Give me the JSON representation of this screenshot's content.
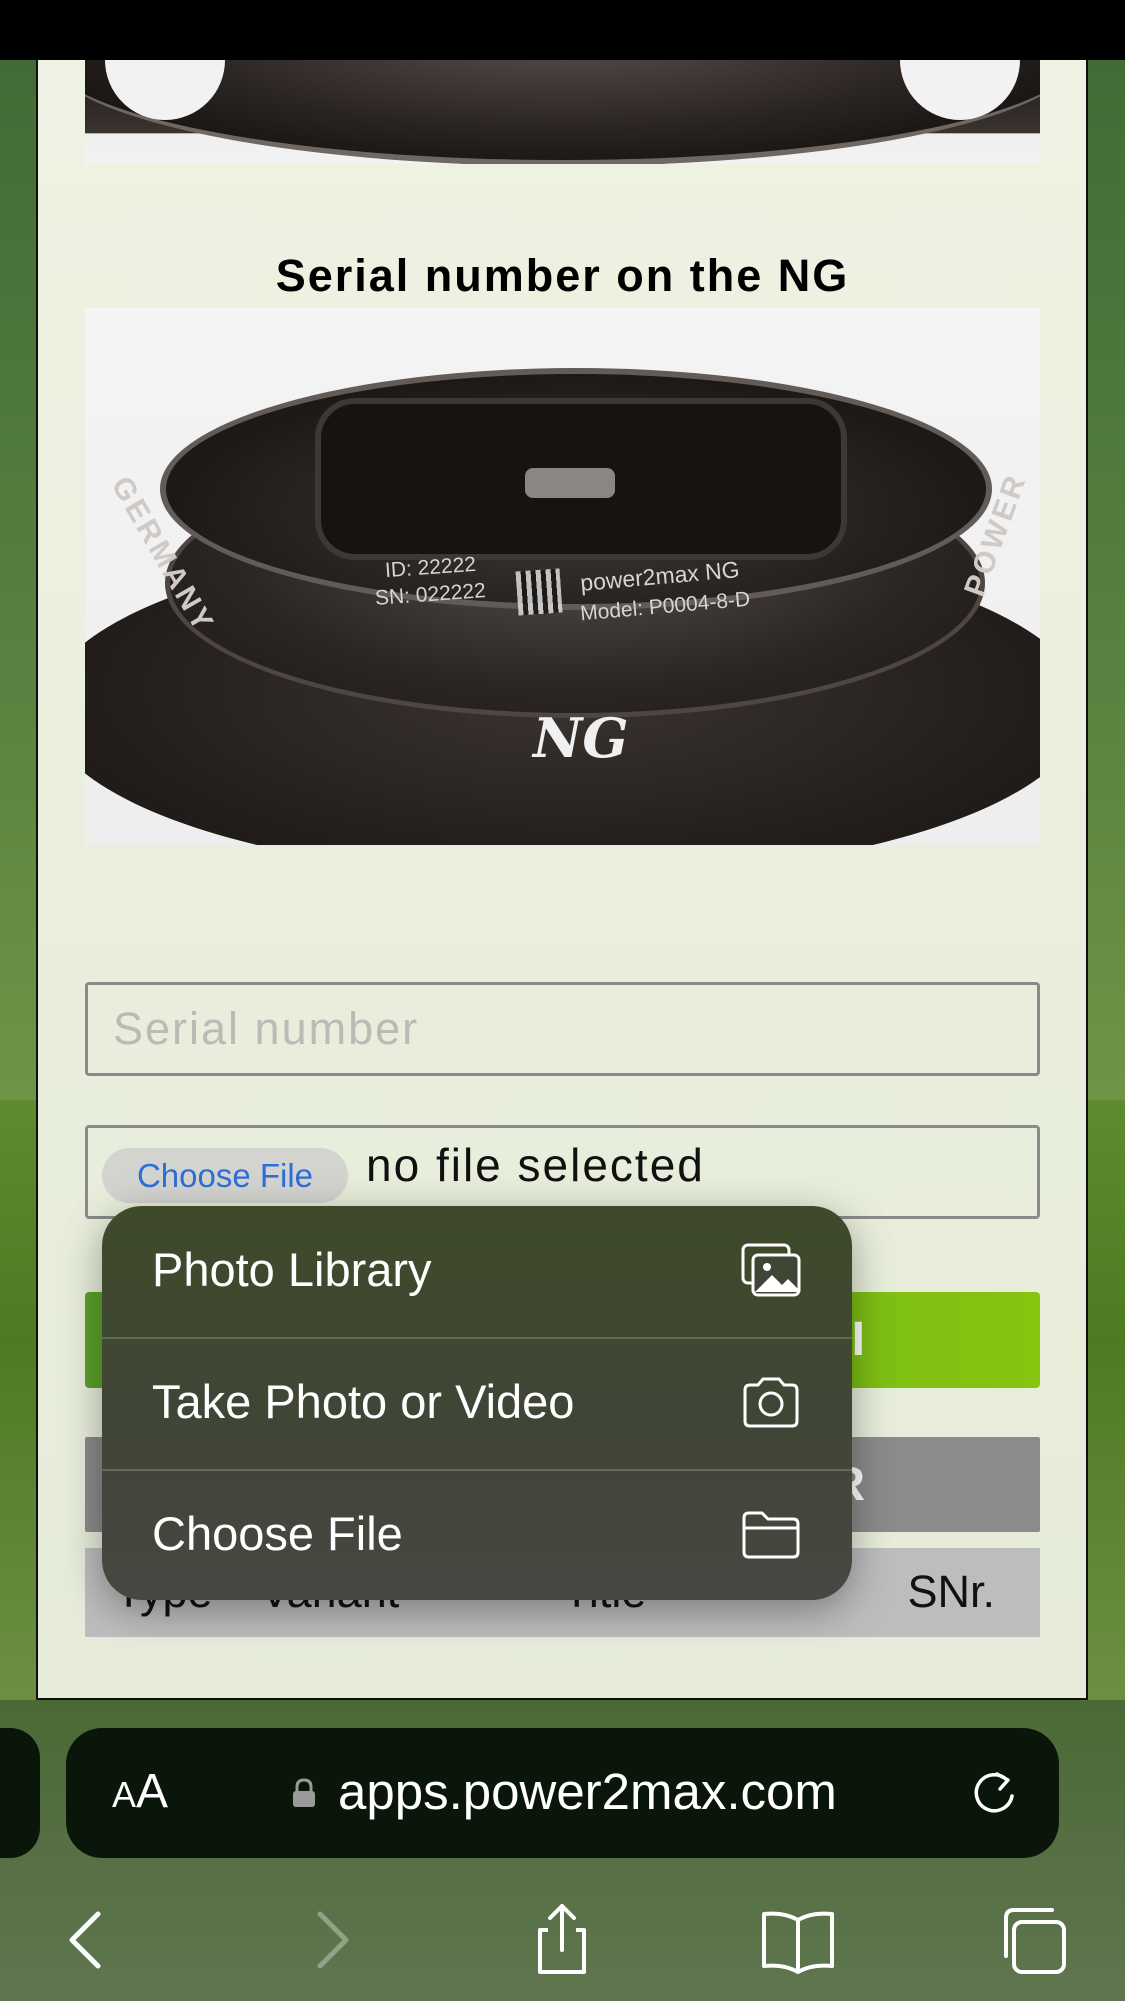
{
  "page": {
    "section_title": "Serial number on the NG",
    "photo_engraving": {
      "id_line": "ID:  22222",
      "sn_line": "SN: 022222",
      "brand_line": "power2max NG",
      "model_line": "Model: P0004-8-D",
      "left_text": "GERMANY",
      "right_text": "POWER",
      "logo": "NG"
    },
    "serial_input": {
      "placeholder": "Serial number",
      "value": ""
    },
    "file_input": {
      "button_label": "Choose File",
      "status_text": "no file selected"
    },
    "green_button_visible_text": "I",
    "gray_button_visible_text": "R",
    "table": {
      "headers": [
        "Type",
        "Variant",
        "Title",
        "SNr."
      ]
    }
  },
  "popover": {
    "items": [
      {
        "label": "Photo Library",
        "icon": "photo-library-icon"
      },
      {
        "label": "Take Photo or Video",
        "icon": "camera-icon"
      },
      {
        "label": "Choose File",
        "icon": "folder-icon"
      }
    ]
  },
  "browser": {
    "text_size_label_small": "A",
    "text_size_label_big": "A",
    "url": "apps.power2max.com",
    "toolbar_icons": [
      "back-icon",
      "forward-icon",
      "share-icon",
      "bookmarks-icon",
      "tabs-icon"
    ]
  },
  "colors": {
    "accent_green": "#72b81a",
    "link_blue": "#2e6fd6",
    "popover_bg": "#404636",
    "url_bar_bg": "#0a1609"
  }
}
